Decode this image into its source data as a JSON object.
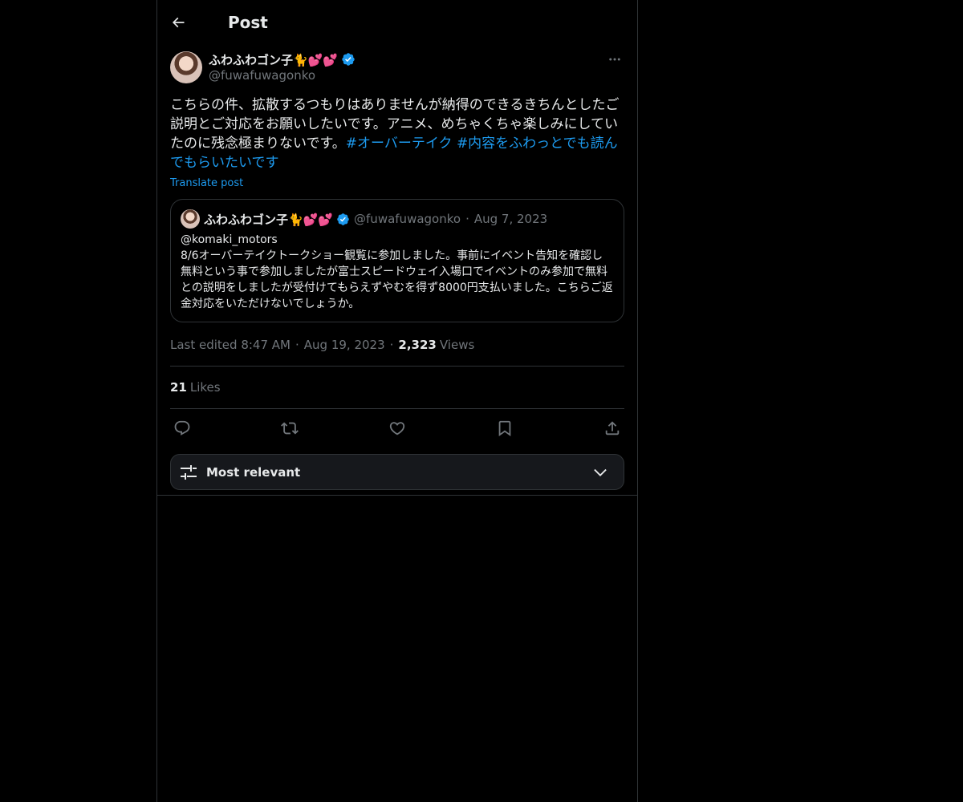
{
  "header": {
    "title": "Post"
  },
  "post": {
    "author": {
      "display_name": "ふわふわゴン子🐈💕💕",
      "handle": "@fuwafuwagonko"
    },
    "text_plain": "こちらの件、拡散するつもりはありませんが納得のできるきちんとしたご説明とご対応をお願いしたいです。アニメ、めちゃくちゃ楽しみにしていたのに残念極まりないです。",
    "hashtags": [
      "#オーバーテイク",
      "#内容をふわっとでも読んでもらいたいです"
    ],
    "translate_label": "Translate post",
    "quote": {
      "display_name": "ふわふわゴン子🐈💕💕",
      "handle": "@fuwafuwagonko",
      "date": "Aug 7, 2023",
      "mention": "@komaki_motors",
      "body": "8/6オーバーテイクトークショー観覧に参加しました。事前にイベント告知を確認し無料という事で参加しましたが富士スピードウェイ入場口でイベントのみ参加で無料との説明をしましたが受付けてもらえずやむを得ず8000円支払いました。こちらご返金対応をいただけないでしょうか。"
    },
    "meta": {
      "edited_time": "Last edited 8:47 AM",
      "date": "Aug 19, 2023",
      "views_count": "2,323",
      "views_label": "Views"
    },
    "likes": {
      "count": "21",
      "label": "Likes"
    }
  },
  "sort": {
    "label": "Most relevant"
  },
  "icons": {
    "back": "back-arrow-icon",
    "more": "more-icon",
    "verified": "verified-badge-icon",
    "reply": "reply-icon",
    "repost": "repost-icon",
    "like": "like-icon",
    "bookmark": "bookmark-icon",
    "share": "share-icon",
    "sort": "sliders-icon",
    "chevron": "chevron-down-icon"
  },
  "colors": {
    "background": "#000000",
    "text": "#e7e9ea",
    "secondary": "#71767b",
    "accent": "#1d9bf0",
    "border": "#2f3336"
  }
}
